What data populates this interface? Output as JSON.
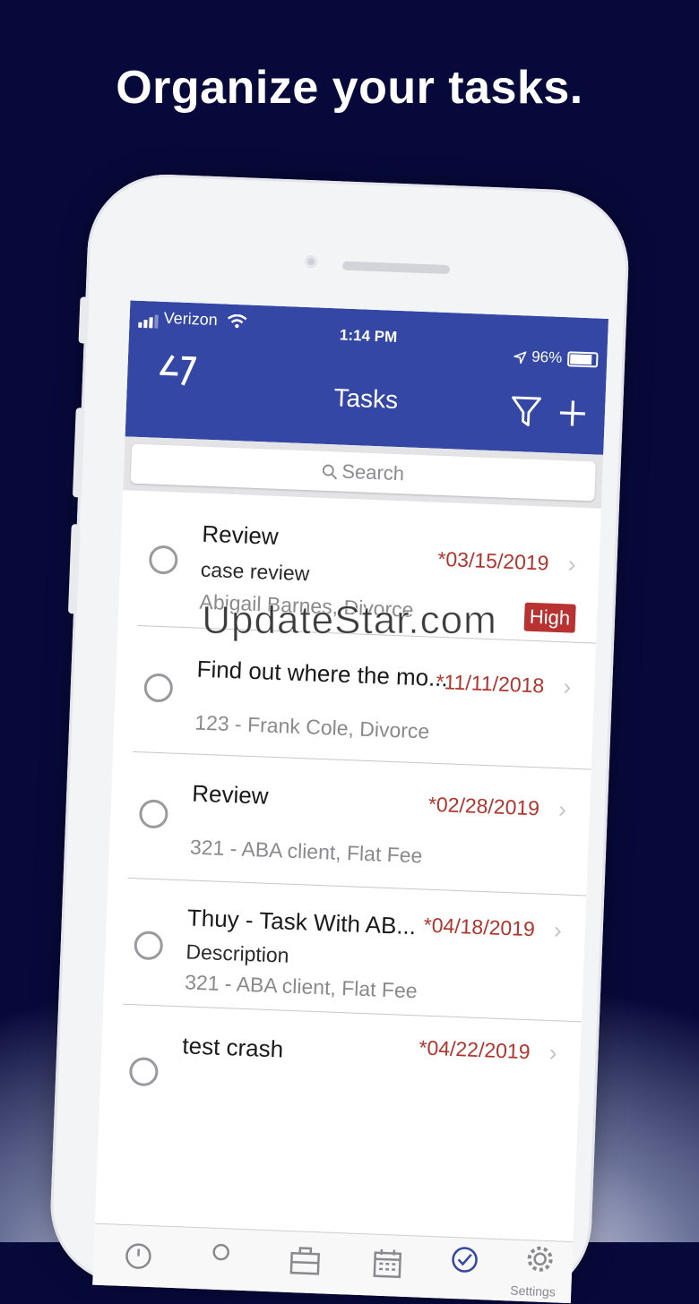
{
  "headline": "Organize your tasks.",
  "status_bar": {
    "carrier": "Verizon",
    "time": "1:14 PM",
    "battery": "96%"
  },
  "nav": {
    "title": "Tasks"
  },
  "search": {
    "placeholder": "Search"
  },
  "tasks": [
    {
      "title": "Review",
      "description": "case review",
      "matter": "Abigail Barnes, Divorce",
      "date": "*03/15/2019",
      "priority": "High"
    },
    {
      "title": "Find out where the mo...",
      "description": "",
      "matter": "123 - Frank Cole, Divorce",
      "date": "*11/11/2018",
      "priority": ""
    },
    {
      "title": "Review",
      "description": "",
      "matter": "321 - ABA client, Flat Fee",
      "date": "*02/28/2019",
      "priority": ""
    },
    {
      "title": "Thuy - Task With AB...",
      "description": "Description",
      "matter": "321 - ABA client, Flat Fee",
      "date": "*04/18/2019",
      "priority": ""
    },
    {
      "title": "test crash",
      "description": "",
      "matter": "",
      "date": "*04/22/2019",
      "priority": ""
    }
  ],
  "tabbar": {
    "settings_label": "Settings",
    "active_tab": "tasks"
  },
  "watermark": "UpdateStar.com",
  "colors": {
    "nav": "#3447a4",
    "date": "#b2342d",
    "badge": "#b83232",
    "background": "#060836"
  }
}
